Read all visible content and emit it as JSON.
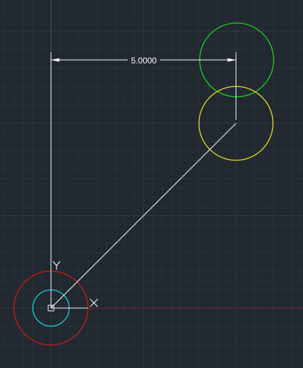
{
  "dimension": {
    "value": "5.0000"
  },
  "ucs": {
    "x_label": "X",
    "y_label": "Y"
  },
  "colors": {
    "background": "#212830",
    "grid_minor": "#2a313a",
    "grid_major": "#323a44",
    "x_axis": "#7a2a2a",
    "y_axis": "#2f6a35",
    "green_circle": "#1ed31e",
    "yellow_circle": "#e5e11a",
    "red_circle": "#d11a1a",
    "cyan_circle": "#1ad0e0",
    "lines": "#ffffff"
  }
}
